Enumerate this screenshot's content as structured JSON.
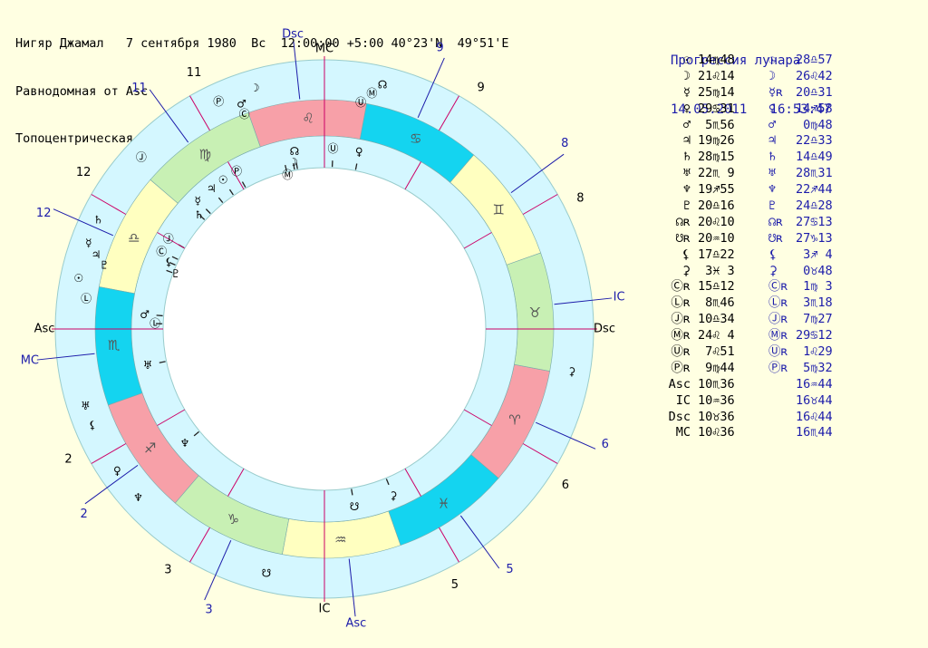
{
  "header": {
    "line1": "Нигяр Джамал   7 сентября 1980  Вс  12:00:00 +5:00 40°23'N  49°51'E",
    "line2": "Равнодомная от Asc",
    "line3": "Топоцентрическая"
  },
  "progression": {
    "title": "Прогрессия лунара",
    "datetime": "14.05.2011   16:53:47"
  },
  "colors": {
    "background": "#ffffe2",
    "outer_ring": "#d4f7ff",
    "fire": "#f7a0a8",
    "earth": "#c8f0b4",
    "air": "#ffffc0",
    "water": "#14d4f0",
    "natal_cusp_line": "#cc0066",
    "progressed_cusp_line": "#1c1caa",
    "progressed_text": "#1c1caa",
    "zodiac_glyph": "#555555"
  },
  "zodiac": {
    "signs": [
      {
        "glyph": "♈",
        "element": "fire"
      },
      {
        "glyph": "♉",
        "element": "earth"
      },
      {
        "glyph": "♊",
        "element": "air"
      },
      {
        "glyph": "♋",
        "element": "water"
      },
      {
        "glyph": "♌",
        "element": "fire"
      },
      {
        "glyph": "♍",
        "element": "earth"
      },
      {
        "glyph": "♎",
        "element": "air"
      },
      {
        "glyph": "♏",
        "element": "water"
      },
      {
        "glyph": "♐",
        "element": "fire"
      },
      {
        "glyph": "♑",
        "element": "earth"
      },
      {
        "glyph": "♒",
        "element": "air"
      },
      {
        "glyph": "♓",
        "element": "water"
      }
    ]
  },
  "natal_cusps": [
    {
      "house": "1",
      "lon": 220.6
    },
    {
      "house": "2",
      "lon": 250.6
    },
    {
      "house": "3",
      "lon": 280.6
    },
    {
      "house": "4",
      "lon": 310.6
    },
    {
      "house": "5",
      "lon": 340.6
    },
    {
      "house": "6",
      "lon": 10.6
    },
    {
      "house": "7",
      "lon": 40.6
    },
    {
      "house": "8",
      "lon": 70.6
    },
    {
      "house": "9",
      "lon": 100.6
    },
    {
      "house": "10",
      "lon": 130.6
    },
    {
      "house": "11",
      "lon": 160.6
    },
    {
      "house": "12",
      "lon": 190.6
    }
  ],
  "progressed_cusps": [
    {
      "house": "1",
      "lon": 226.73
    },
    {
      "house": "2",
      "lon": 256.73
    },
    {
      "house": "3",
      "lon": 286.73
    },
    {
      "house": "4",
      "lon": 316.73
    },
    {
      "house": "5",
      "lon": 346.73
    },
    {
      "house": "6",
      "lon": 16.73
    },
    {
      "house": "7",
      "lon": 46.73
    },
    {
      "house": "8",
      "lon": 76.73
    },
    {
      "house": "9",
      "lon": 106.73
    },
    {
      "house": "10",
      "lon": 136.73
    },
    {
      "house": "11",
      "lon": 166.73
    },
    {
      "house": "12",
      "lon": 196.73
    }
  ],
  "angles": {
    "natal": {
      "asc": "Asc",
      "mc": "MC",
      "dsc": "Dsc",
      "ic": "IC",
      "asc_lon": 220.6,
      "mc_lon": 130.6
    },
    "progressed": {
      "asc": "Asc",
      "mc": "MC",
      "dsc": "Dsc",
      "ic": "IC",
      "asc_lon": 316.73,
      "mc_lon": 226.73
    }
  },
  "natal_planets": [
    {
      "glyph": "☉",
      "lon": 164.8
    },
    {
      "glyph": "☽",
      "lon": 141.23
    },
    {
      "glyph": "☿",
      "lon": 175.23
    },
    {
      "glyph": "♀",
      "lon": 119.52
    },
    {
      "glyph": "♂",
      "lon": 215.93
    },
    {
      "glyph": "♃",
      "lon": 169.43
    },
    {
      "glyph": "♄",
      "lon": 178.25
    },
    {
      "glyph": "♅",
      "lon": 232.15
    },
    {
      "glyph": "♆",
      "lon": 259.92
    },
    {
      "glyph": "♇",
      "lon": 200.27
    },
    {
      "glyph": "☊",
      "lon": 140.17
    },
    {
      "glyph": "☋",
      "lon": 320.17
    },
    {
      "glyph": "⚸",
      "lon": 197.37
    },
    {
      "glyph": "⚳",
      "lon": 333.05
    },
    {
      "glyph": "Ⓒ",
      "lon": 195.2
    },
    {
      "glyph": "Ⓛ",
      "lon": 218.77
    },
    {
      "glyph": "Ⓙ",
      "lon": 190.57
    },
    {
      "glyph": "Ⓜ",
      "lon": 144.07
    },
    {
      "glyph": "Ⓤ",
      "lon": 127.85
    },
    {
      "glyph": "Ⓟ",
      "lon": 159.73
    }
  ],
  "progressed_planets": [
    {
      "glyph": "☉",
      "lon": 208.95
    },
    {
      "glyph": "☽",
      "lon": 146.7
    },
    {
      "glyph": "☿",
      "lon": 200.52
    },
    {
      "glyph": "♀",
      "lon": 254.97
    },
    {
      "glyph": "♂",
      "lon": 150.8
    },
    {
      "glyph": "♃",
      "lon": 202.55
    },
    {
      "glyph": "♄",
      "lon": 194.82
    },
    {
      "glyph": "♅",
      "lon": 238.52
    },
    {
      "glyph": "♆",
      "lon": 262.73
    },
    {
      "glyph": "♇",
      "lon": 204.47
    },
    {
      "glyph": "☊",
      "lon": 117.22
    },
    {
      "glyph": "☋",
      "lon": 297.22
    },
    {
      "glyph": "⚸",
      "lon": 243.07
    },
    {
      "glyph": "⚳",
      "lon": 30.8
    },
    {
      "glyph": "Ⓒ",
      "lon": 151.05
    },
    {
      "glyph": "Ⓛ",
      "lon": 213.3
    },
    {
      "glyph": "Ⓙ",
      "lon": 177.45
    },
    {
      "glyph": "Ⓜ",
      "lon": 119.2
    },
    {
      "glyph": "Ⓤ",
      "lon": 121.48
    },
    {
      "glyph": "Ⓟ",
      "lon": 155.53
    }
  ],
  "table": {
    "rows": [
      {
        "sym1": "☉",
        "pos1": "14♍48",
        "sym2": "☉",
        "pos2": "28♎57"
      },
      {
        "sym1": "☽",
        "pos1": "21♌14",
        "sym2": "☽",
        "pos2": "26♌42"
      },
      {
        "sym1": "☿",
        "pos1": "25♍14",
        "sym2": "☿ʀ",
        "pos2": "20♎31"
      },
      {
        "sym1": "♀",
        "pos1": "29♋31",
        "sym2": "♀",
        "pos2": "14♐58"
      },
      {
        "sym1": "♂",
        "pos1": " 5♏56",
        "sym2": "♂",
        "pos2": " 0♍48"
      },
      {
        "sym1": "♃",
        "pos1": "19♍26",
        "sym2": "♃",
        "pos2": "22♎33"
      },
      {
        "sym1": "♄",
        "pos1": "28♍15",
        "sym2": "♄",
        "pos2": "14♎49"
      },
      {
        "sym1": "♅",
        "pos1": "22♏ 9",
        "sym2": "♅",
        "pos2": "28♏31"
      },
      {
        "sym1": "♆",
        "pos1": "19♐55",
        "sym2": "♆",
        "pos2": "22♐44"
      },
      {
        "sym1": "♇",
        "pos1": "20♎16",
        "sym2": "♇",
        "pos2": "24♎28"
      },
      {
        "sym1": "☊ʀ",
        "pos1": "20♌10",
        "sym2": "☊ʀ",
        "pos2": "27♋13"
      },
      {
        "sym1": "☋ʀ",
        "pos1": "20♒10",
        "sym2": "☋ʀ",
        "pos2": "27♑13"
      },
      {
        "sym1": "⚸",
        "pos1": "17♎22",
        "sym2": "⚸",
        "pos2": " 3♐ 4"
      },
      {
        "sym1": "⚳",
        "pos1": " 3♓ 3",
        "sym2": "⚳",
        "pos2": " 0♉48"
      },
      {
        "sym1": "Ⓒʀ",
        "pos1": "15♎12",
        "sym2": "Ⓒʀ",
        "pos2": " 1♍ 3"
      },
      {
        "sym1": "Ⓛʀ",
        "pos1": " 8♏46",
        "sym2": "Ⓛʀ",
        "pos2": " 3♏18"
      },
      {
        "sym1": "Ⓙʀ",
        "pos1": "10♎34",
        "sym2": "Ⓙʀ",
        "pos2": " 7♍27"
      },
      {
        "sym1": "Ⓜʀ",
        "pos1": "24♌ 4",
        "sym2": "Ⓜʀ",
        "pos2": "29♋12"
      },
      {
        "sym1": "Ⓤʀ",
        "pos1": " 7♌51",
        "sym2": "Ⓤʀ",
        "pos2": " 1♌29"
      },
      {
        "sym1": "Ⓟʀ",
        "pos1": " 9♍44",
        "sym2": "Ⓟʀ",
        "pos2": " 5♍32"
      },
      {
        "sym1": "Asc",
        "pos1": "10♏36",
        "sym2": "",
        "pos2": "16♒44"
      },
      {
        "sym1": "IC",
        "pos1": "10♒36",
        "sym2": "",
        "pos2": "16♉44"
      },
      {
        "sym1": "Dsc",
        "pos1": "10♉36",
        "sym2": "",
        "pos2": "16♌44"
      },
      {
        "sym1": "MC",
        "pos1": "10♌36",
        "sym2": "",
        "pos2": "16♏44"
      }
    ]
  }
}
